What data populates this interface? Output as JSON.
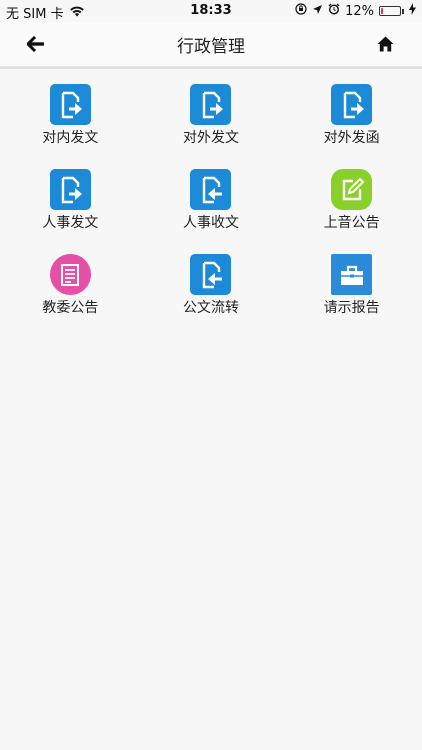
{
  "status_bar": {
    "carrier": "无 SIM 卡",
    "time": "18:33",
    "battery": "12%",
    "battery_level": 0.12,
    "battery_color": "#e23b2e"
  },
  "nav": {
    "title": "行政管理",
    "back_icon": "arrow-left-icon",
    "home_icon": "home-icon"
  },
  "colors": {
    "doc_blue": "#1c8ad6",
    "notice_green": "#8bcf2a",
    "notice_pink": "#e54fa6",
    "report_blue": "#2a8bd8"
  },
  "grid": {
    "items": [
      {
        "label": "对内发文",
        "icon": "send-document-icon"
      },
      {
        "label": "对外发文",
        "icon": "send-document-icon"
      },
      {
        "label": "对外发函",
        "icon": "send-document-icon"
      },
      {
        "label": "人事发文",
        "icon": "send-document-icon"
      },
      {
        "label": "人事收文",
        "icon": "receive-document-icon"
      },
      {
        "label": "上音公告",
        "icon": "edit-notice-icon"
      },
      {
        "label": "教委公告",
        "icon": "notice-list-icon"
      },
      {
        "label": "公文流转",
        "icon": "receive-document-icon"
      },
      {
        "label": "请示报告",
        "icon": "briefcase-icon"
      }
    ]
  }
}
